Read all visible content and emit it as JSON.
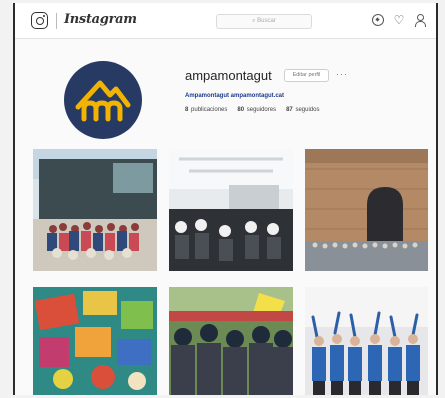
{
  "nav": {
    "logo": "Instagram",
    "search_placeholder": "⌕ Buscar",
    "icons": [
      "camera-icon",
      "compass-icon",
      "heart-icon",
      "profile-icon"
    ]
  },
  "profile": {
    "username": "ampamontagut",
    "edit_label": "Editar perfil",
    "more_label": "···",
    "bio": "Ampamontagut ampamontagut.cat",
    "stats": {
      "posts_value": "8",
      "posts_label": "publicaciones",
      "followers_value": "80",
      "followers_label": "seguidores",
      "following_value": "87",
      "following_label": "seguidos"
    },
    "avatar_colors": {
      "background": "#273a64",
      "accent": "#f2b400"
    }
  },
  "posts": [
    {
      "alt": "group-outdoors-photo"
    },
    {
      "alt": "auditorium-audience-photo"
    },
    {
      "alt": "stone-castle-gate-photo"
    },
    {
      "alt": "colorful-crafts-photo"
    },
    {
      "alt": "market-crowd-photo"
    },
    {
      "alt": "blue-shirts-group-photo"
    }
  ]
}
